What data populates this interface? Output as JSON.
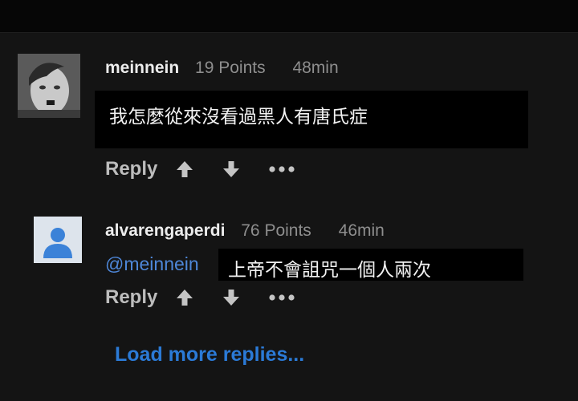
{
  "comments": [
    {
      "username": "meinnein",
      "points": "19 Points",
      "time": "48min",
      "text": "我怎麼從來沒看過黑人有唐氏症",
      "avatar": "photo-avatar",
      "reply_label": "Reply"
    },
    {
      "username": "alvarengaperdi",
      "points": "76 Points",
      "time": "46min",
      "mention": "@meinnein",
      "text": "上帝不會詛咒一個人兩次",
      "avatar": "default-person-avatar",
      "reply_label": "Reply"
    }
  ],
  "load_more_label": "Load more replies...",
  "icons": {
    "upvote": "arrow-up-icon",
    "downvote": "arrow-down-icon",
    "more": "more-dots-icon"
  },
  "colors": {
    "background": "#141414",
    "mention": "#4e87d9",
    "link": "#2b7ad6",
    "muted": "#8e8e8e"
  }
}
